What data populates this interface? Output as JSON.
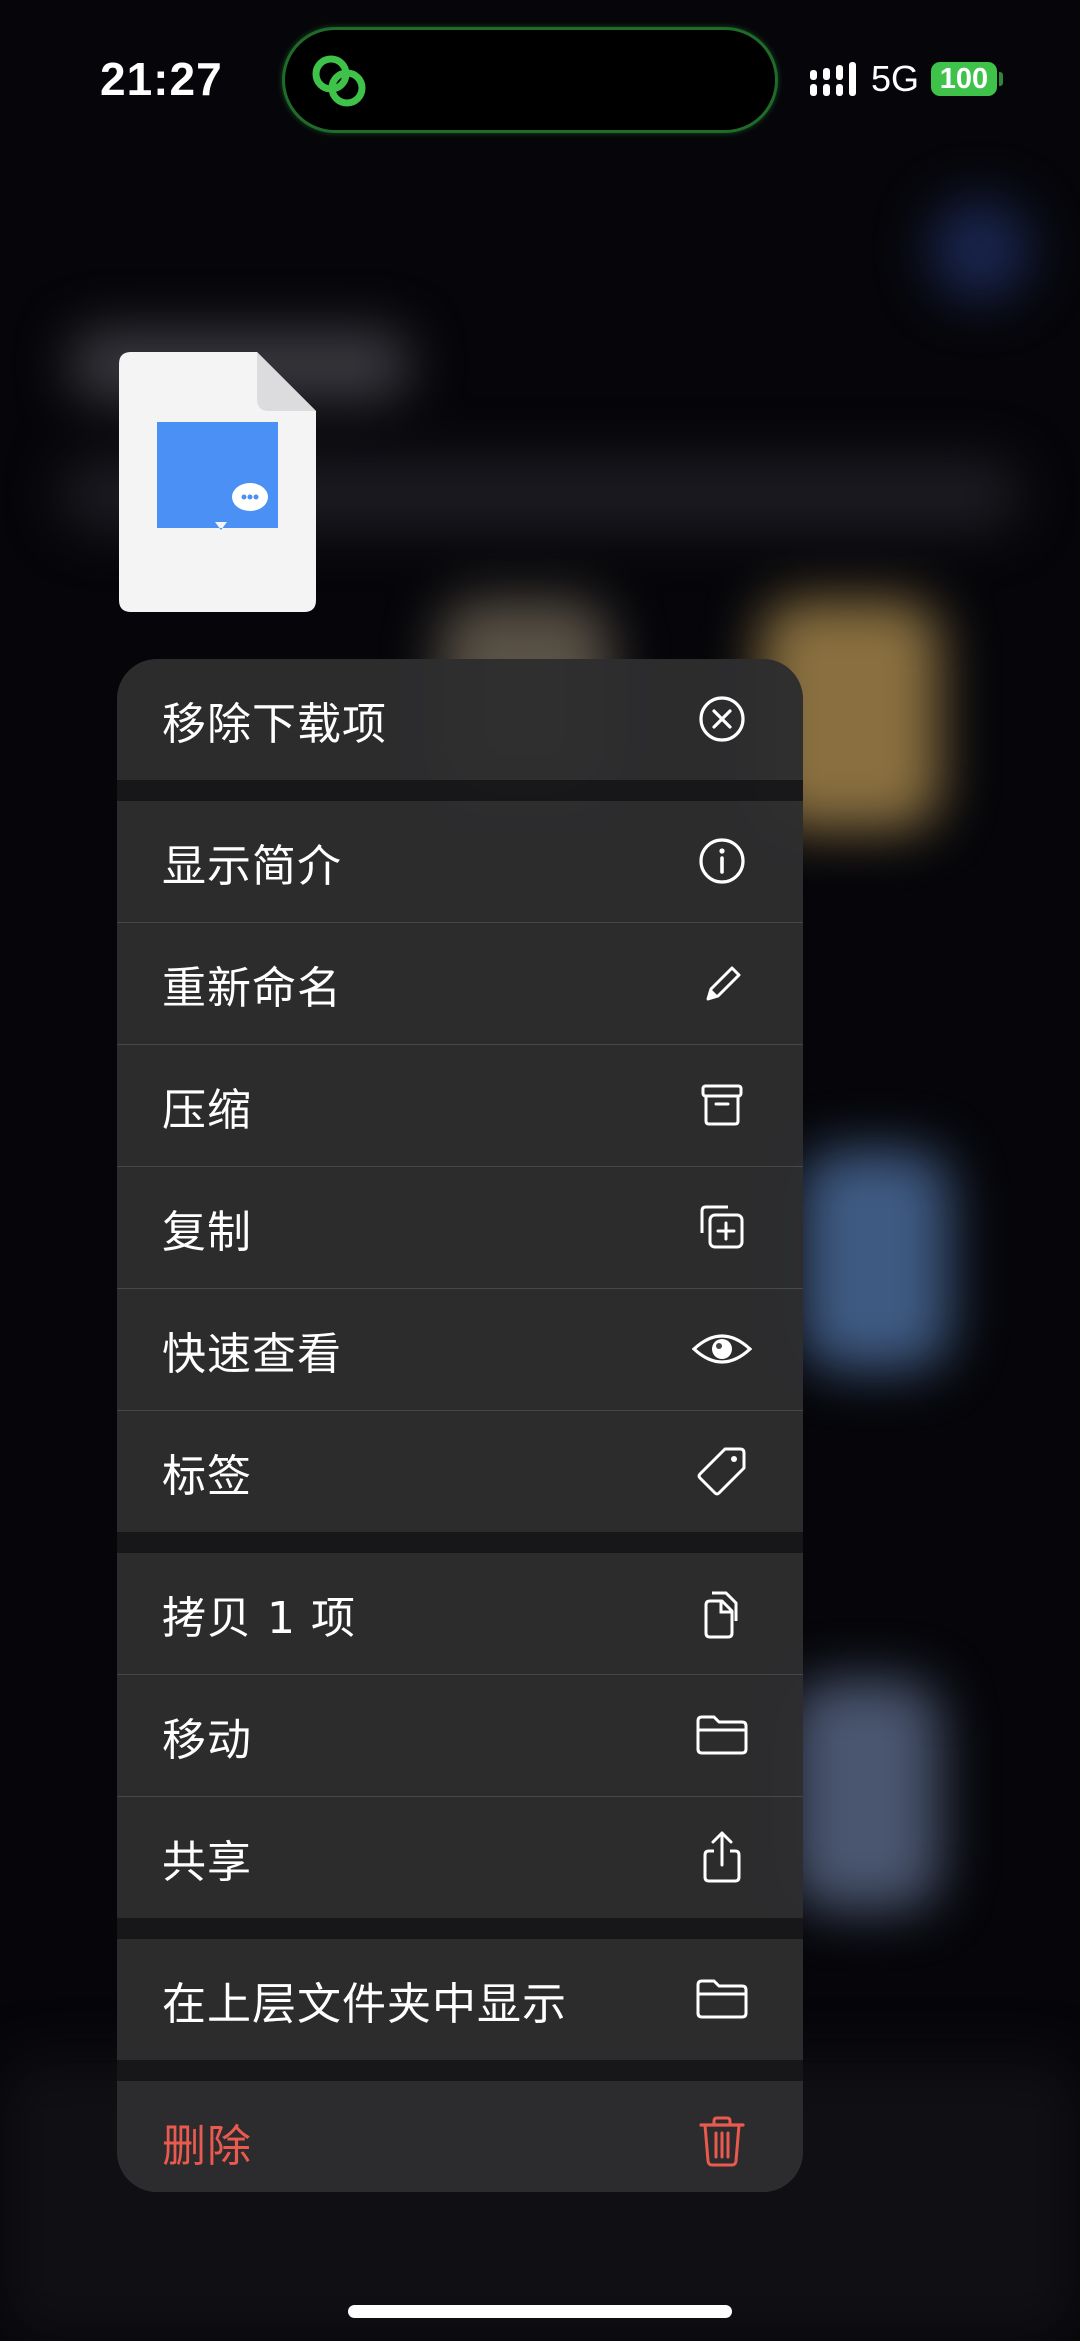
{
  "status_bar": {
    "time": "21:27",
    "network": "5G",
    "battery": "100",
    "island_app_icon": "link-rings-icon",
    "accent_color": "#3ec24a"
  },
  "file": {
    "icon": "document-with-chat-icon",
    "accent_color": "#4a90f5"
  },
  "menu": {
    "items": [
      {
        "label": "移除下载项",
        "icon": "circle-x-icon"
      },
      {
        "label": "显示简介",
        "icon": "info-circle-icon"
      },
      {
        "label": "重新命名",
        "icon": "pencil-icon"
      },
      {
        "label": "压缩",
        "icon": "archive-box-icon"
      },
      {
        "label": "复制",
        "icon": "duplicate-plus-icon"
      },
      {
        "label": "快速查看",
        "icon": "eye-icon"
      },
      {
        "label": "标签",
        "icon": "tag-icon"
      },
      {
        "label": "拷贝 1 项",
        "icon": "copy-documents-icon"
      },
      {
        "label": "移动",
        "icon": "folder-icon"
      },
      {
        "label": "共享",
        "icon": "share-icon"
      },
      {
        "label": "在上层文件夹中显示",
        "icon": "folder-icon"
      },
      {
        "label": "删除",
        "icon": "trash-icon",
        "color": "#ea5a4e"
      }
    ]
  }
}
